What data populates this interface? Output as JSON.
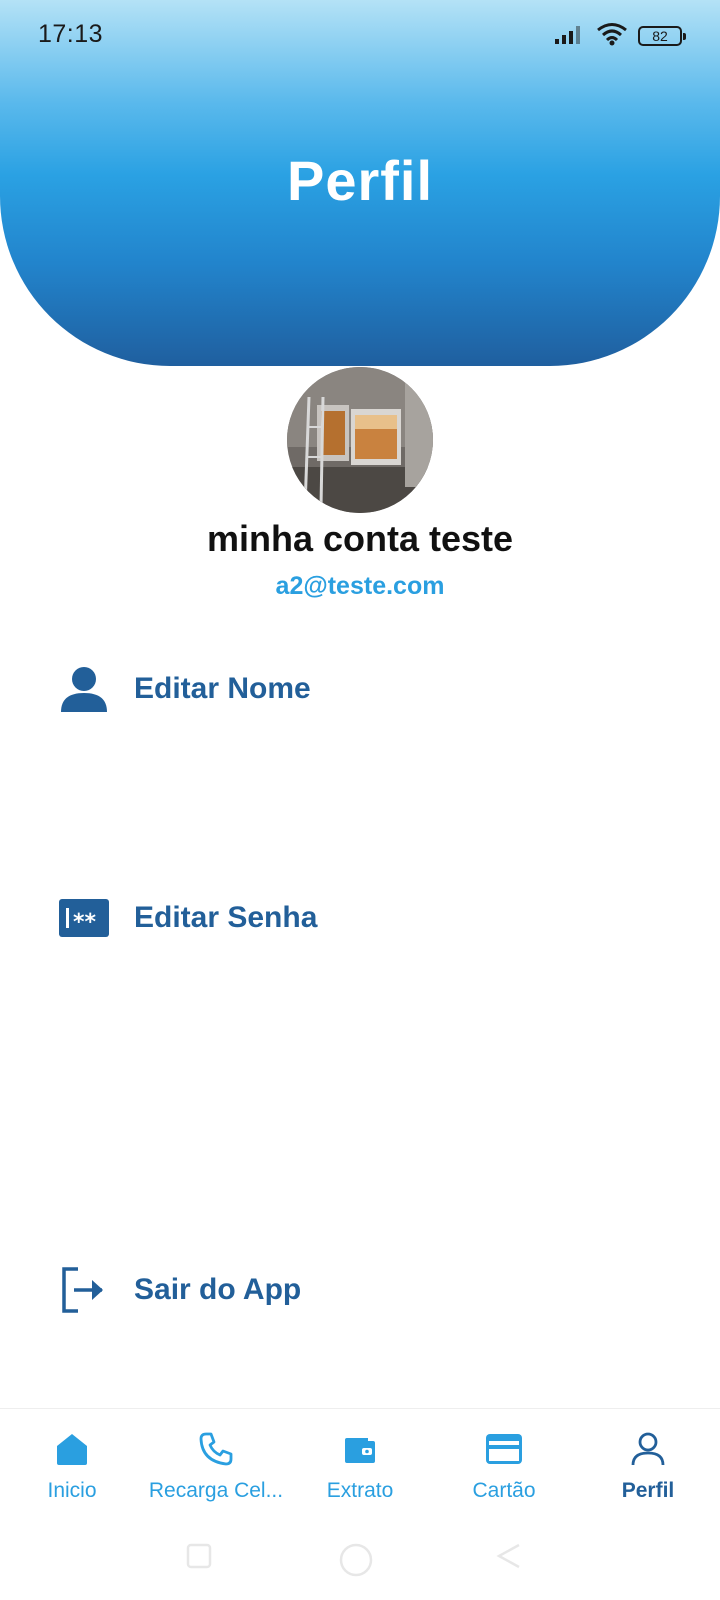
{
  "status_bar": {
    "time": "17:13",
    "battery": "82",
    "icons": [
      "signal-icon",
      "wifi-icon",
      "battery-icon"
    ]
  },
  "header": {
    "title": "Perfil"
  },
  "profile": {
    "name": "minha conta teste",
    "email": "a2@teste.com"
  },
  "menu": {
    "edit_name": "Editar Nome",
    "edit_password": "Editar Senha",
    "logout": "Sair do App"
  },
  "bottom_nav": {
    "items": [
      {
        "label": "Inicio",
        "icon": "home-icon"
      },
      {
        "label": "Recarga Cel...",
        "icon": "phone-icon"
      },
      {
        "label": "Extrato",
        "icon": "wallet-icon"
      },
      {
        "label": "Cartão",
        "icon": "card-icon"
      },
      {
        "label": "Perfil",
        "icon": "person-icon"
      }
    ],
    "active": "Perfil"
  },
  "colors": {
    "accent": "#2a9fe0",
    "dark_blue": "#225f99",
    "header_gradient_top": "#b4e2f6",
    "header_gradient_bottom": "#1f5f9f"
  }
}
